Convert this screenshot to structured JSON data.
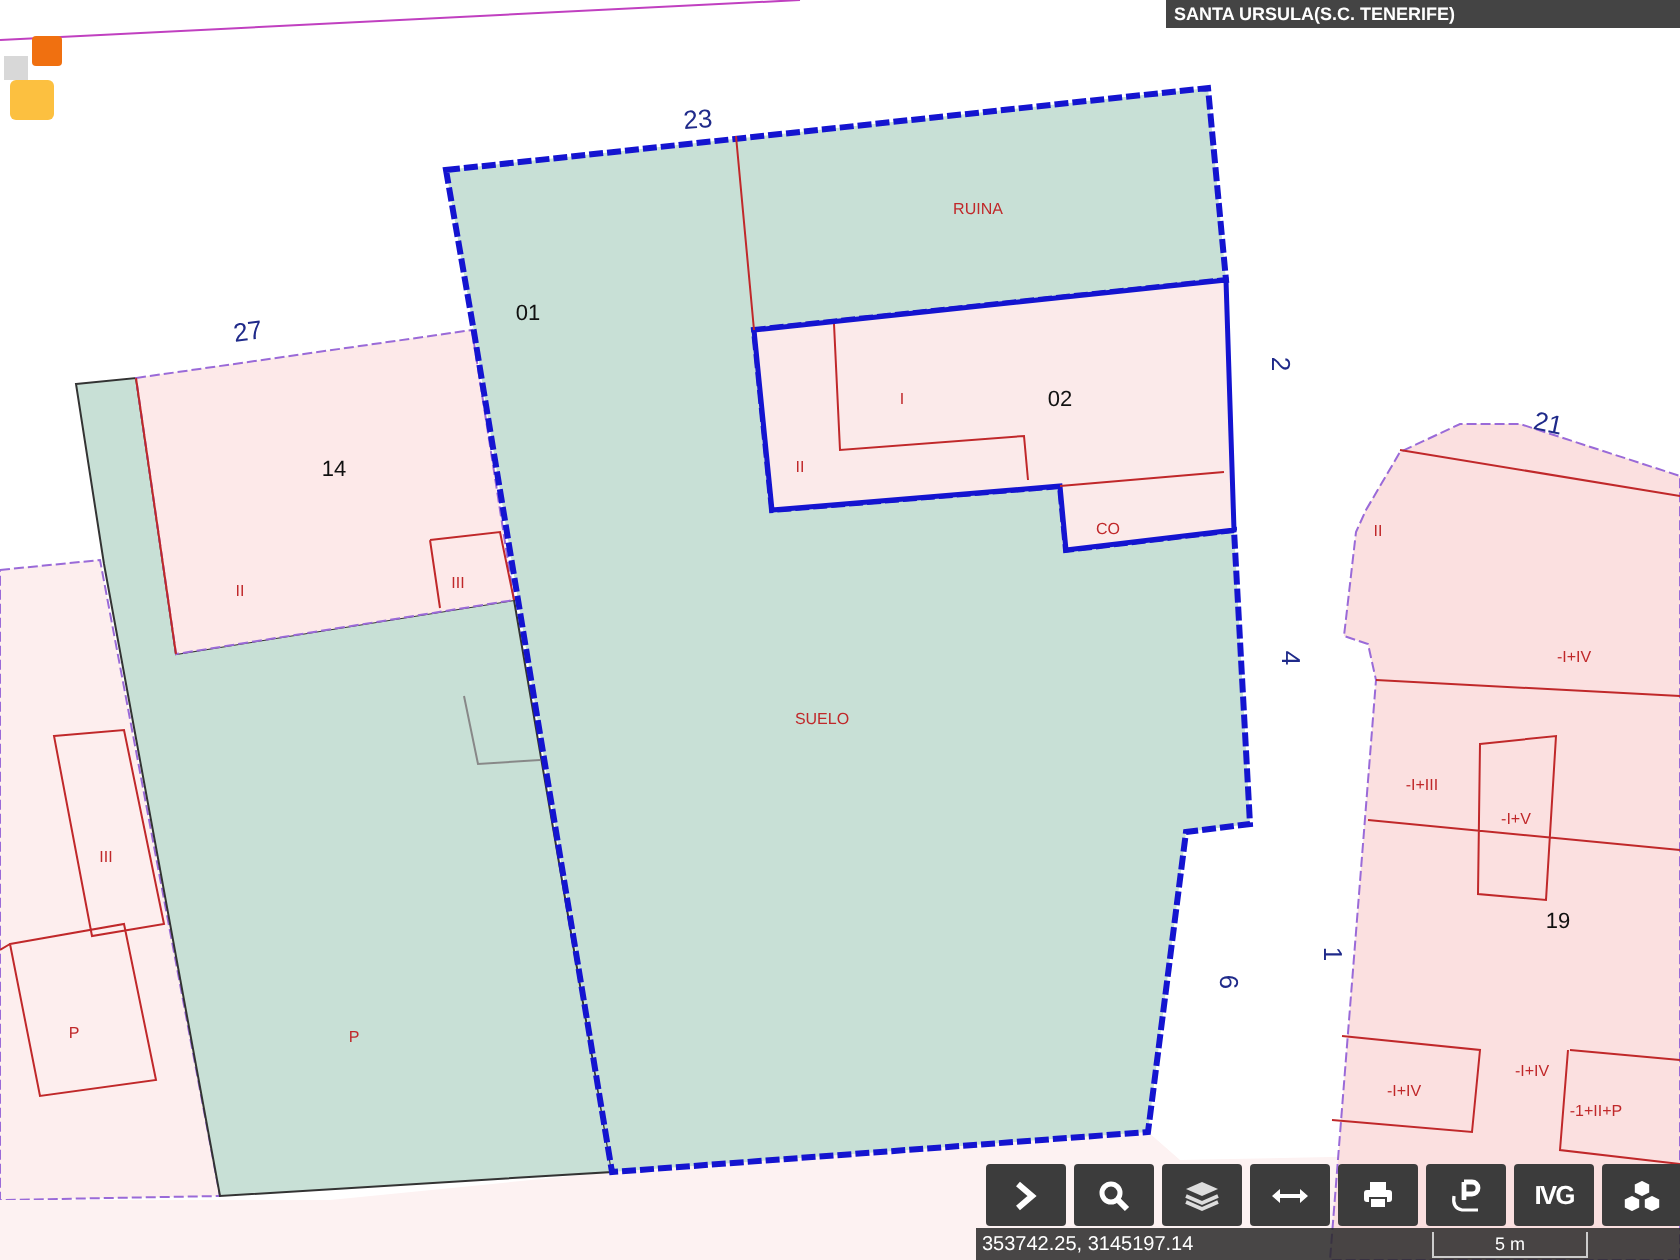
{
  "header": {
    "municipality": "SANTA URSULA(S.C. TENERIFE)"
  },
  "map": {
    "labels": [
      {
        "kind": "block",
        "text": "23"
      },
      {
        "kind": "block",
        "text": "27"
      },
      {
        "kind": "block",
        "text": "21"
      },
      {
        "kind": "block",
        "text": "2"
      },
      {
        "kind": "block",
        "text": "4"
      },
      {
        "kind": "block",
        "text": "6"
      },
      {
        "kind": "block",
        "text": "1"
      },
      {
        "kind": "parcel",
        "text": "01"
      },
      {
        "kind": "parcel",
        "text": "02"
      },
      {
        "kind": "parcel",
        "text": "14"
      },
      {
        "kind": "parcel",
        "text": "19"
      },
      {
        "kind": "floors",
        "text": "RUINA"
      },
      {
        "kind": "floors",
        "text": "I"
      },
      {
        "kind": "floors",
        "text": "II"
      },
      {
        "kind": "floors",
        "text": "CO"
      },
      {
        "kind": "floors",
        "text": "II"
      },
      {
        "kind": "floors",
        "text": "III"
      },
      {
        "kind": "floors",
        "text": "SUELO"
      },
      {
        "kind": "floors",
        "text": "III"
      },
      {
        "kind": "floors",
        "text": "P"
      },
      {
        "kind": "floors",
        "text": "P"
      },
      {
        "kind": "floors",
        "text": "II"
      },
      {
        "kind": "floors",
        "text": "-I+IV"
      },
      {
        "kind": "floors",
        "text": "-I+III"
      },
      {
        "kind": "floors",
        "text": "-I+V"
      },
      {
        "kind": "floors",
        "text": "-I+IV"
      },
      {
        "kind": "floors",
        "text": "-I+IV"
      },
      {
        "kind": "floors",
        "text": "-1+II+P"
      }
    ]
  },
  "toolbar": [
    {
      "kind": "expand"
    },
    {
      "kind": "search"
    },
    {
      "kind": "layers"
    },
    {
      "kind": "measure"
    },
    {
      "kind": "print"
    },
    {
      "kind": "parking"
    },
    {
      "kind": "text",
      "label": "IVG"
    },
    {
      "kind": "buildings"
    }
  ],
  "status_bar": {
    "coordinates": "353742.25, 3145197.14",
    "scale": "5 m"
  }
}
